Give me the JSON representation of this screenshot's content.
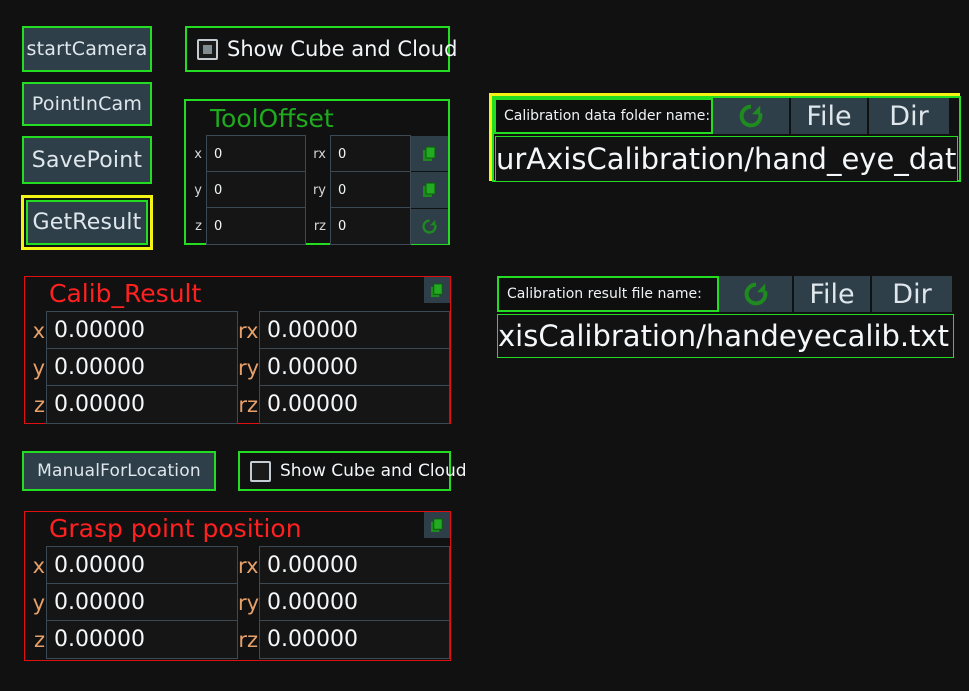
{
  "buttons": {
    "start_camera": "startCamera",
    "point_in_cam": "PointInCam",
    "save_point": "SavePoint",
    "get_result": "GetResult",
    "manual_for_location": "ManualForLocation"
  },
  "checkboxes": {
    "top": {
      "label": "Show Cube and Cloud",
      "state": "partial"
    },
    "bottom": {
      "label": "Show Cube and Cloud",
      "state": "unchecked"
    }
  },
  "tool_offset": {
    "title": "ToolOffset",
    "rows": [
      {
        "tag": "x",
        "value": "0",
        "tag2": "rx",
        "value2": "0"
      },
      {
        "tag": "y",
        "value": "0",
        "tag2": "ry",
        "value2": "0"
      },
      {
        "tag": "z",
        "value": "0",
        "tag2": "rz",
        "value2": "0"
      }
    ],
    "side_icons": [
      "copy-icon",
      "copy-icon",
      "refresh-icon"
    ]
  },
  "calib_result": {
    "title": "Calib_Result",
    "corner_icon": "copy-icon",
    "rows": [
      {
        "tag": "x",
        "value": "0.00000",
        "tag2": "rx",
        "value2": "0.00000"
      },
      {
        "tag": "y",
        "value": "0.00000",
        "tag2": "ry",
        "value2": "0.00000"
      },
      {
        "tag": "z",
        "value": "0.00000",
        "tag2": "rz",
        "value2": "0.00000"
      }
    ]
  },
  "grasp_point": {
    "title": "Grasp point position",
    "corner_icon": "copy-icon",
    "rows": [
      {
        "tag": "x",
        "value": "0.00000",
        "tag2": "rx",
        "value2": "0.00000"
      },
      {
        "tag": "y",
        "value": "0.00000",
        "tag2": "ry",
        "value2": "0.00000"
      },
      {
        "tag": "z",
        "value": "0.00000",
        "tag2": "rz",
        "value2": "0.00000"
      }
    ]
  },
  "data_folder": {
    "label": "Calibration data folder name:",
    "refresh_icon": "refresh-icon",
    "file_button": "File",
    "dir_button": "Dir",
    "path": "urAxisCalibration/hand_eye_data",
    "focused": true
  },
  "result_file": {
    "label": "Calibration result file name:",
    "refresh_icon": "refresh-icon",
    "file_button": "File",
    "dir_button": "Dir",
    "path": "xisCalibration/handeyecalib.txt",
    "focused": false
  },
  "colors": {
    "background": "#111111",
    "accent_green": "#22dd22",
    "focus_yellow": "#f4f414",
    "panel_red": "#e01010",
    "button_fill": "#2e3f4a",
    "tag_orange": "#e8a06a"
  }
}
